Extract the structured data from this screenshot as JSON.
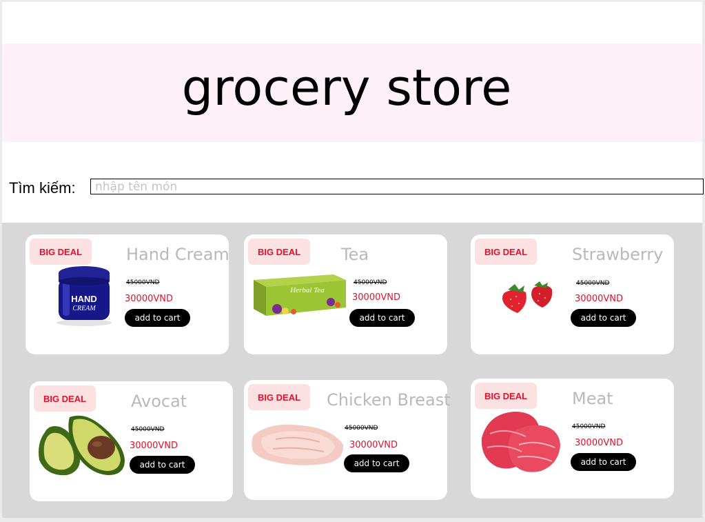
{
  "header": {
    "title": "grocery store"
  },
  "search": {
    "label": "Tìm kiếm:",
    "placeholder": "nhập tên món",
    "value": ""
  },
  "products": [
    {
      "name": "Hand Cream",
      "badge": "BIG DEAL",
      "old_price": "45000VND",
      "new_price": "30000VND",
      "button": "add to cart"
    },
    {
      "name": "Tea",
      "badge": "BIG DEAL",
      "old_price": "45000VND",
      "new_price": "30000VND",
      "button": "add to cart"
    },
    {
      "name": "Strawberry",
      "badge": "BIG DEAL",
      "old_price": "45000VND",
      "new_price": "30000VND",
      "button": "add to cart"
    },
    {
      "name": "Avocat",
      "badge": "BIG DEAL",
      "old_price": "45000VND",
      "new_price": "30000VND",
      "button": "add to cart"
    },
    {
      "name": "Chicken Breast",
      "badge": "BIG DEAL",
      "old_price": "45000VND",
      "new_price": "30000VND",
      "button": "add to cart"
    },
    {
      "name": "Meat",
      "badge": "BIG DEAL",
      "old_price": "45000VND",
      "new_price": "30000VND",
      "button": "add to cart"
    }
  ],
  "herbal_tea_box": {
    "label": "Herbal Tea"
  },
  "colors": {
    "banner_bg": "#fdf1f7",
    "grid_bg": "#d8d8d8",
    "badge_bg": "#fce1e3",
    "accent_red": "#e2112a",
    "product_name": "#b9b9b9",
    "button_bg": "#000000"
  }
}
